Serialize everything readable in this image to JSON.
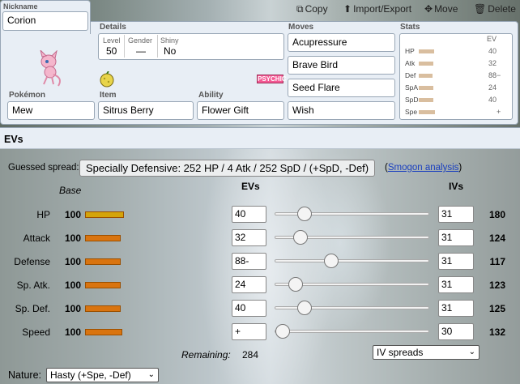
{
  "toolbar": {
    "copy": "Copy",
    "import_export": "Import/Export",
    "move": "Move",
    "delete": "Delete"
  },
  "nickname": {
    "label": "Nickname",
    "value": "Corion"
  },
  "details": {
    "label": "Details",
    "level_label": "Level",
    "level": "50",
    "gender_label": "Gender",
    "gender": "—",
    "shiny_label": "Shiny",
    "shiny": "No"
  },
  "pokemon": {
    "label": "Pokémon",
    "value": "Mew",
    "type_badge": "PSYCHIC"
  },
  "item": {
    "label": "Item",
    "value": "Sitrus Berry"
  },
  "ability": {
    "label": "Ability",
    "value": "Flower Gift"
  },
  "moves": {
    "label": "Moves",
    "list": [
      "Acupressure",
      "Brave Bird",
      "Seed Flare",
      "Wish"
    ]
  },
  "stats_summary": {
    "label": "Stats",
    "ev_header": "EV",
    "rows": [
      {
        "name": "HP",
        "ev": "40"
      },
      {
        "name": "Atk",
        "ev": "32"
      },
      {
        "name": "Def",
        "ev": "88−"
      },
      {
        "name": "SpA",
        "ev": "24"
      },
      {
        "name": "SpD",
        "ev": "40"
      },
      {
        "name": "Spe",
        "ev": "+"
      }
    ]
  },
  "evs_section": {
    "title": "EVs",
    "guessed_label": "Guessed spread:",
    "guessed_value": "Specially Defensive: 252 HP / 4 Atk / 252 SpD / (+SpD, -Def)",
    "link_open": "(",
    "link_text": "Smogon analysis",
    "link_close": ")",
    "col_base": "Base",
    "col_evs": "EVs",
    "col_ivs": "IVs",
    "stats": [
      {
        "name": "HP",
        "base": "100",
        "ev": "40",
        "iv": "31",
        "total": "180",
        "ev_fraction": 0.157,
        "bar_color": "#d4a40a"
      },
      {
        "name": "Attack",
        "base": "100",
        "ev": "32",
        "iv": "31",
        "total": "124",
        "ev_fraction": 0.125,
        "bar_color": "#d9740f"
      },
      {
        "name": "Defense",
        "base": "100",
        "ev": "88-",
        "iv": "31",
        "total": "117",
        "ev_fraction": 0.345,
        "bar_color": "#d9740f"
      },
      {
        "name": "Sp. Atk.",
        "base": "100",
        "ev": "24",
        "iv": "31",
        "total": "123",
        "ev_fraction": 0.094,
        "bar_color": "#d9740f"
      },
      {
        "name": "Sp. Def.",
        "base": "100",
        "ev": "40",
        "iv": "31",
        "total": "125",
        "ev_fraction": 0.157,
        "bar_color": "#d9740f"
      },
      {
        "name": "Speed",
        "base": "100",
        "ev": "+",
        "iv": "30",
        "total": "132",
        "ev_fraction": 0.0,
        "bar_color": "#d9740f"
      }
    ],
    "remaining_label": "Remaining:",
    "remaining_value": "284",
    "iv_select": "IV spreads",
    "nature_label": "Nature:",
    "nature_value": "Hasty (+Spe, -Def)"
  }
}
